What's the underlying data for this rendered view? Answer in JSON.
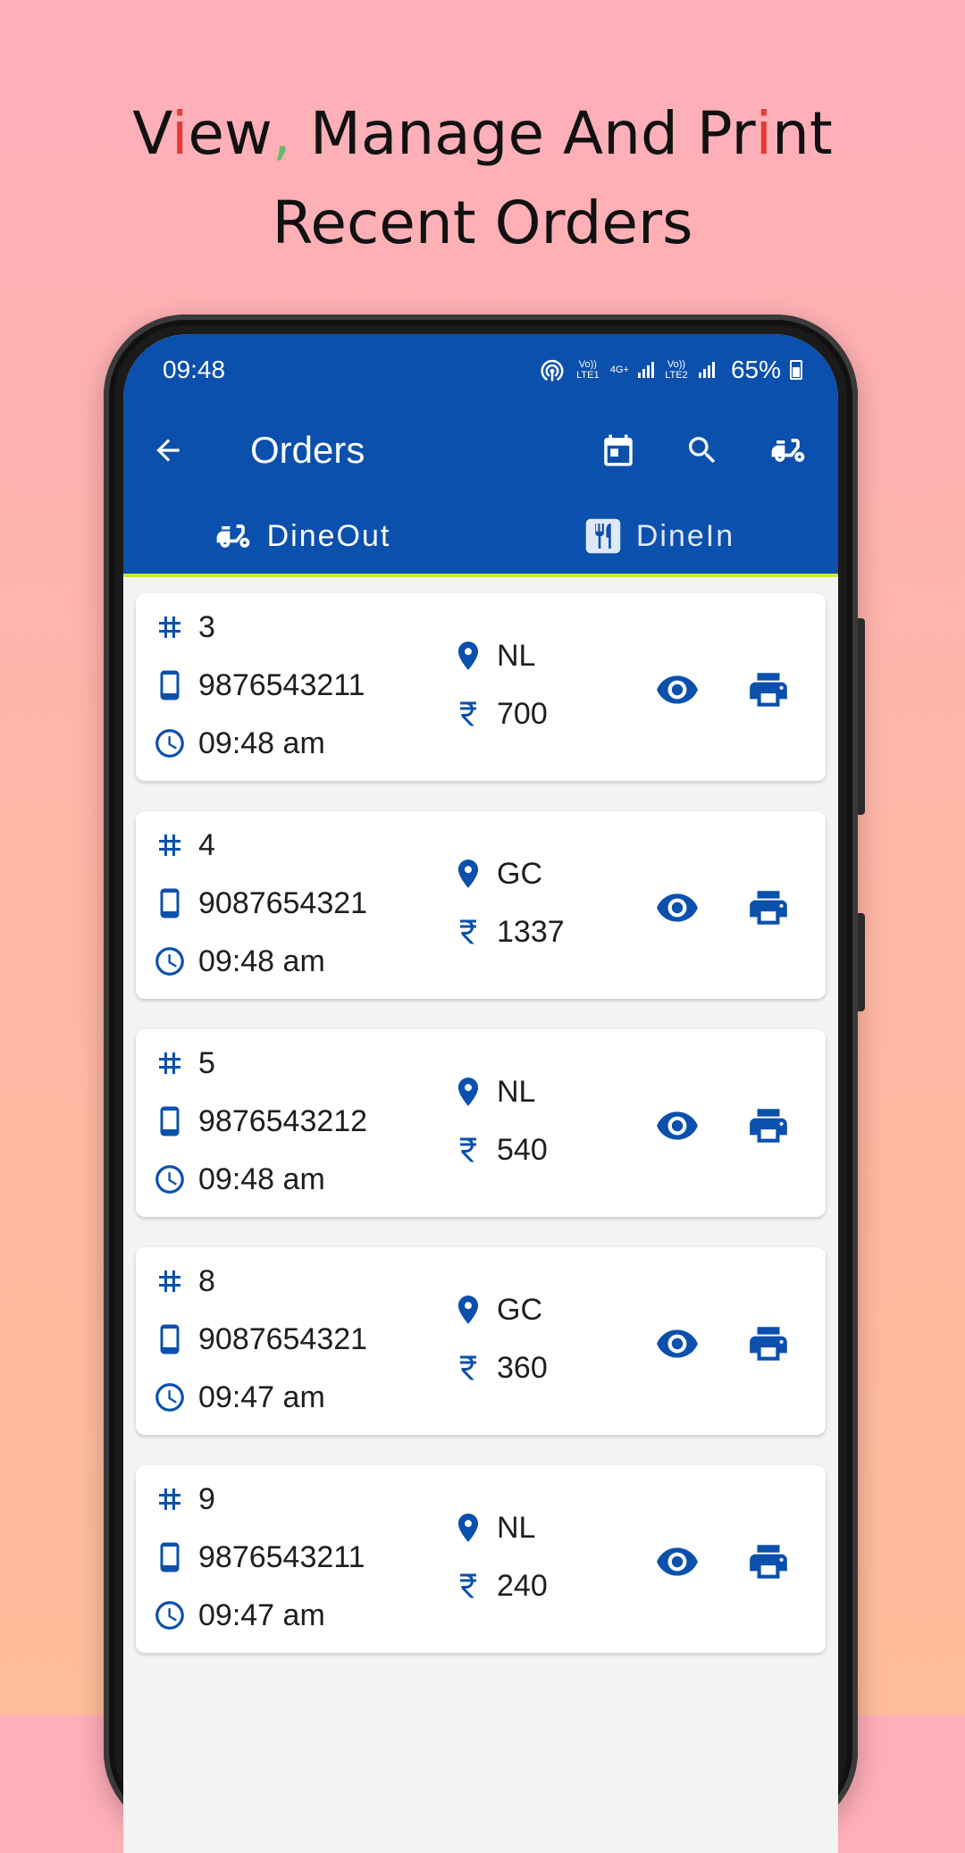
{
  "promo": {
    "line1_part1": "V",
    "line1_i": "i",
    "line1_part2": "ew",
    "line1_comma": ",",
    "line1_part3": " Manage And Pr",
    "line1_i2": "i",
    "line1_part4": "nt",
    "line2": "Recent Orders"
  },
  "status_bar": {
    "time": "09:48",
    "lte1": "Vo)) LTE1",
    "net": "4G+",
    "lte2": "Vo)) LTE2",
    "battery": "65%"
  },
  "toolbar": {
    "title": "Orders",
    "icons": [
      "back-arrow-icon",
      "calendar-icon",
      "search-icon",
      "scooter-icon"
    ]
  },
  "tabs": [
    {
      "label": "DineOut",
      "icon": "scooter-icon",
      "selected": true
    },
    {
      "label": "DineIn",
      "icon": "restaurant-icon",
      "selected": false
    }
  ],
  "colors": {
    "primary": "#0b50ad",
    "tab_indicator": "#c6e93a",
    "icon": "#0b50ad"
  },
  "orders": [
    {
      "id": "3",
      "phone": "9876543211",
      "time": "09:48 am",
      "location": "NL",
      "amount": "700"
    },
    {
      "id": "4",
      "phone": "9087654321",
      "time": "09:48 am",
      "location": "GC",
      "amount": "1337"
    },
    {
      "id": "5",
      "phone": "9876543212",
      "time": "09:48 am",
      "location": "NL",
      "amount": "540"
    },
    {
      "id": "8",
      "phone": "9087654321",
      "time": "09:47 am",
      "location": "GC",
      "amount": "360"
    },
    {
      "id": "9",
      "phone": "9876543211",
      "time": "09:47 am",
      "location": "NL",
      "amount": "240"
    }
  ]
}
